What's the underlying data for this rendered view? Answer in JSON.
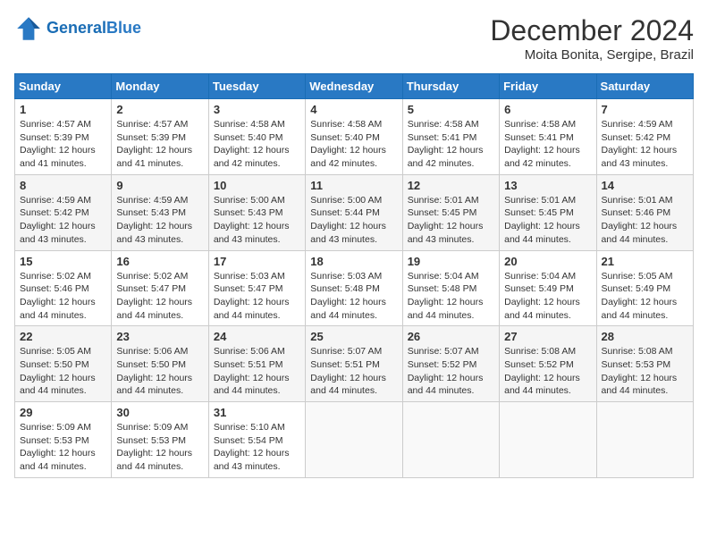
{
  "header": {
    "logo_line1": "General",
    "logo_line2": "Blue",
    "title": "December 2024",
    "subtitle": "Moita Bonita, Sergipe, Brazil"
  },
  "calendar": {
    "days_of_week": [
      "Sunday",
      "Monday",
      "Tuesday",
      "Wednesday",
      "Thursday",
      "Friday",
      "Saturday"
    ],
    "weeks": [
      [
        {
          "day": "1",
          "sunrise": "4:57 AM",
          "sunset": "5:39 PM",
          "daylight": "12 hours and 41 minutes."
        },
        {
          "day": "2",
          "sunrise": "4:57 AM",
          "sunset": "5:39 PM",
          "daylight": "12 hours and 41 minutes."
        },
        {
          "day": "3",
          "sunrise": "4:58 AM",
          "sunset": "5:40 PM",
          "daylight": "12 hours and 42 minutes."
        },
        {
          "day": "4",
          "sunrise": "4:58 AM",
          "sunset": "5:40 PM",
          "daylight": "12 hours and 42 minutes."
        },
        {
          "day": "5",
          "sunrise": "4:58 AM",
          "sunset": "5:41 PM",
          "daylight": "12 hours and 42 minutes."
        },
        {
          "day": "6",
          "sunrise": "4:58 AM",
          "sunset": "5:41 PM",
          "daylight": "12 hours and 42 minutes."
        },
        {
          "day": "7",
          "sunrise": "4:59 AM",
          "sunset": "5:42 PM",
          "daylight": "12 hours and 43 minutes."
        }
      ],
      [
        {
          "day": "8",
          "sunrise": "4:59 AM",
          "sunset": "5:42 PM",
          "daylight": "12 hours and 43 minutes."
        },
        {
          "day": "9",
          "sunrise": "4:59 AM",
          "sunset": "5:43 PM",
          "daylight": "12 hours and 43 minutes."
        },
        {
          "day": "10",
          "sunrise": "5:00 AM",
          "sunset": "5:43 PM",
          "daylight": "12 hours and 43 minutes."
        },
        {
          "day": "11",
          "sunrise": "5:00 AM",
          "sunset": "5:44 PM",
          "daylight": "12 hours and 43 minutes."
        },
        {
          "day": "12",
          "sunrise": "5:01 AM",
          "sunset": "5:45 PM",
          "daylight": "12 hours and 43 minutes."
        },
        {
          "day": "13",
          "sunrise": "5:01 AM",
          "sunset": "5:45 PM",
          "daylight": "12 hours and 44 minutes."
        },
        {
          "day": "14",
          "sunrise": "5:01 AM",
          "sunset": "5:46 PM",
          "daylight": "12 hours and 44 minutes."
        }
      ],
      [
        {
          "day": "15",
          "sunrise": "5:02 AM",
          "sunset": "5:46 PM",
          "daylight": "12 hours and 44 minutes."
        },
        {
          "day": "16",
          "sunrise": "5:02 AM",
          "sunset": "5:47 PM",
          "daylight": "12 hours and 44 minutes."
        },
        {
          "day": "17",
          "sunrise": "5:03 AM",
          "sunset": "5:47 PM",
          "daylight": "12 hours and 44 minutes."
        },
        {
          "day": "18",
          "sunrise": "5:03 AM",
          "sunset": "5:48 PM",
          "daylight": "12 hours and 44 minutes."
        },
        {
          "day": "19",
          "sunrise": "5:04 AM",
          "sunset": "5:48 PM",
          "daylight": "12 hours and 44 minutes."
        },
        {
          "day": "20",
          "sunrise": "5:04 AM",
          "sunset": "5:49 PM",
          "daylight": "12 hours and 44 minutes."
        },
        {
          "day": "21",
          "sunrise": "5:05 AM",
          "sunset": "5:49 PM",
          "daylight": "12 hours and 44 minutes."
        }
      ],
      [
        {
          "day": "22",
          "sunrise": "5:05 AM",
          "sunset": "5:50 PM",
          "daylight": "12 hours and 44 minutes."
        },
        {
          "day": "23",
          "sunrise": "5:06 AM",
          "sunset": "5:50 PM",
          "daylight": "12 hours and 44 minutes."
        },
        {
          "day": "24",
          "sunrise": "5:06 AM",
          "sunset": "5:51 PM",
          "daylight": "12 hours and 44 minutes."
        },
        {
          "day": "25",
          "sunrise": "5:07 AM",
          "sunset": "5:51 PM",
          "daylight": "12 hours and 44 minutes."
        },
        {
          "day": "26",
          "sunrise": "5:07 AM",
          "sunset": "5:52 PM",
          "daylight": "12 hours and 44 minutes."
        },
        {
          "day": "27",
          "sunrise": "5:08 AM",
          "sunset": "5:52 PM",
          "daylight": "12 hours and 44 minutes."
        },
        {
          "day": "28",
          "sunrise": "5:08 AM",
          "sunset": "5:53 PM",
          "daylight": "12 hours and 44 minutes."
        }
      ],
      [
        {
          "day": "29",
          "sunrise": "5:09 AM",
          "sunset": "5:53 PM",
          "daylight": "12 hours and 44 minutes."
        },
        {
          "day": "30",
          "sunrise": "5:09 AM",
          "sunset": "5:53 PM",
          "daylight": "12 hours and 44 minutes."
        },
        {
          "day": "31",
          "sunrise": "5:10 AM",
          "sunset": "5:54 PM",
          "daylight": "12 hours and 43 minutes."
        },
        null,
        null,
        null,
        null
      ]
    ],
    "labels": {
      "sunrise": "Sunrise:",
      "sunset": "Sunset:",
      "daylight": "Daylight:"
    }
  }
}
